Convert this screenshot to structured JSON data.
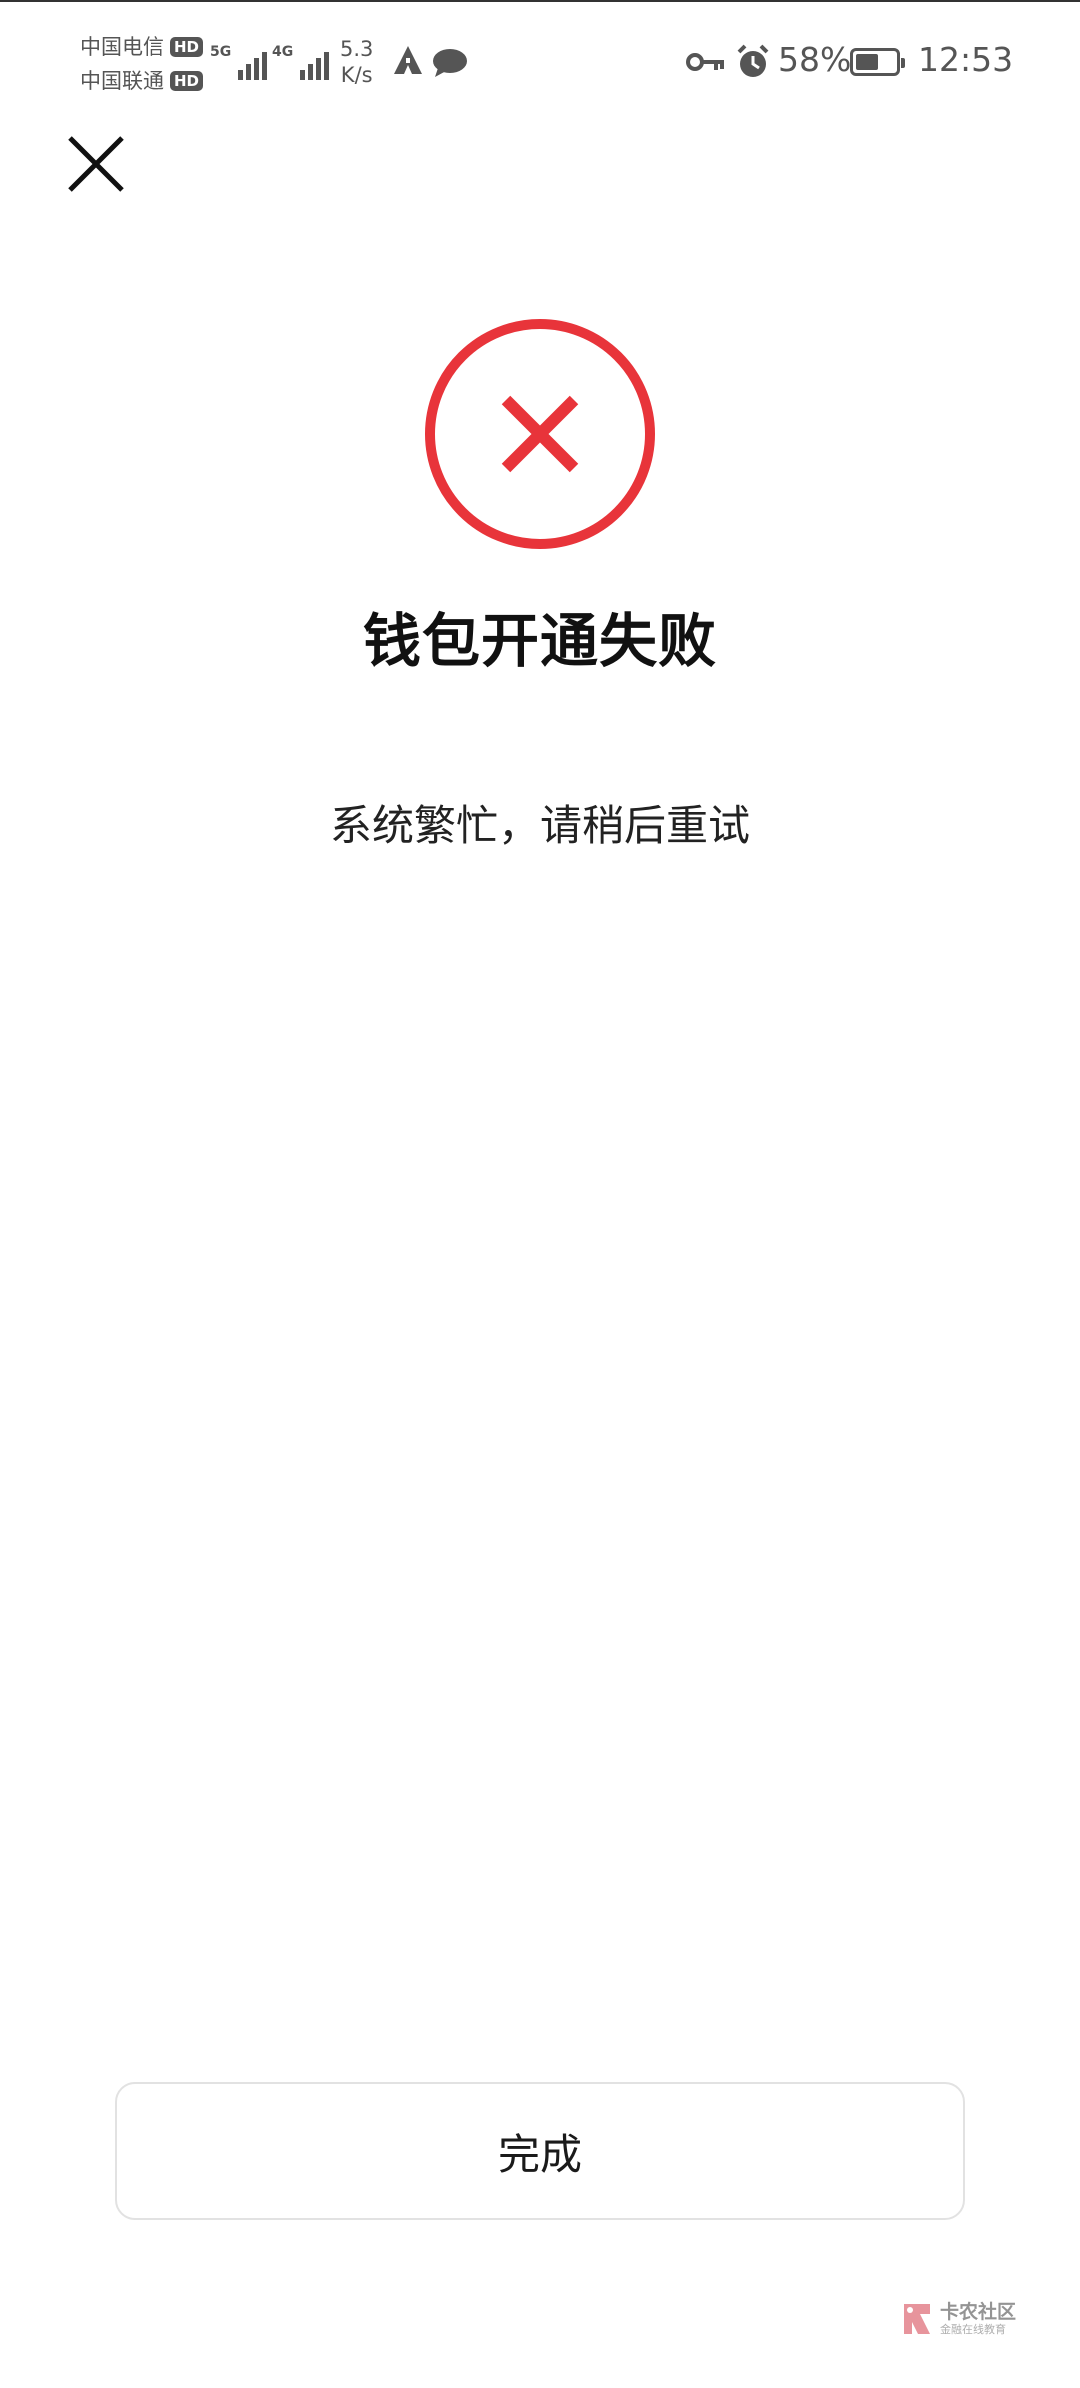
{
  "status_bar": {
    "carrier_1": "中国电信",
    "carrier_2": "中国联通",
    "hd_label": "HD",
    "network_1": "5G",
    "network_2": "4G",
    "speed_value": "5.3",
    "speed_unit": "K/s",
    "battery_percent": "58%",
    "battery_level": 0.58,
    "time": "12:53"
  },
  "dialog": {
    "title": "钱包开通失败",
    "message": "系统繁忙，请稍后重试",
    "done_label": "完成"
  },
  "watermark": {
    "main": "卡农社区",
    "sub": "金融在线教育"
  },
  "colors": {
    "error_red": "#e8343a",
    "text": "#111111",
    "status_gray": "#555555"
  }
}
